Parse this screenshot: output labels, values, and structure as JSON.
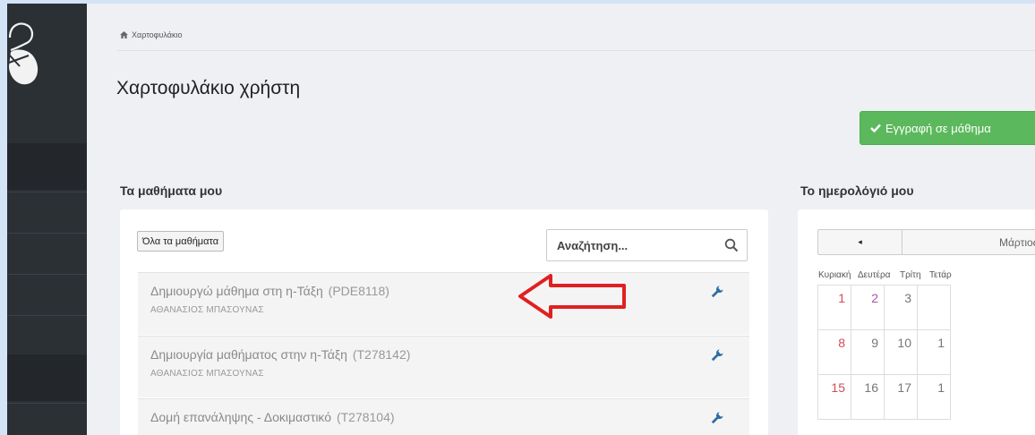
{
  "breadcrumb": {
    "label": "Χαρτοφυλάκιο",
    "icon": "home-icon"
  },
  "page_title": "Χαρτοφυλάκιο χρήστη",
  "register_button": {
    "label": "Εγγραφή σε μάθημα",
    "icon": "check-icon",
    "color": "#5cb85c"
  },
  "courses": {
    "heading": "Τα μαθήματα μου",
    "all_courses_button": "Όλα τα μαθήματα",
    "search_placeholder": "Αναζήτηση...",
    "rows": [
      {
        "title": "Δημιουργώ μάθημα στη η-Τάξη",
        "code": "(PDE8118)",
        "teacher": "ΑΘΑΝΑΣΙΟΣ ΜΠΑΣΟΥΝΑΣ"
      },
      {
        "title": "Δημιουργία μαθήματος στην η-Τάξη",
        "code": "(T278142)",
        "teacher": "ΑΘΑΝΑΣΙΟΣ ΜΠΑΣΟΥΝΑΣ"
      },
      {
        "title": "Δομή επανάληψης - Δοκιμαστικό",
        "code": "(T278104)",
        "teacher": ""
      }
    ]
  },
  "calendar": {
    "heading": "Το ημερολόγιό μου",
    "prev_symbol": "◂",
    "month": "Μάρτιος",
    "weekdays": [
      "Κυριακή",
      "Δευτέρα",
      "Τρίτη",
      "Τετάρ"
    ],
    "weeks": [
      [
        "1",
        "2",
        "3",
        ""
      ],
      [
        "8",
        "9",
        "10",
        "1"
      ],
      [
        "15",
        "16",
        "17",
        "1"
      ]
    ],
    "colors": {
      "sunday": "#d24d57",
      "weekend_alt": "#a855a8",
      "weekday": "#777777"
    }
  },
  "annotation": {
    "color": "#e02020"
  }
}
